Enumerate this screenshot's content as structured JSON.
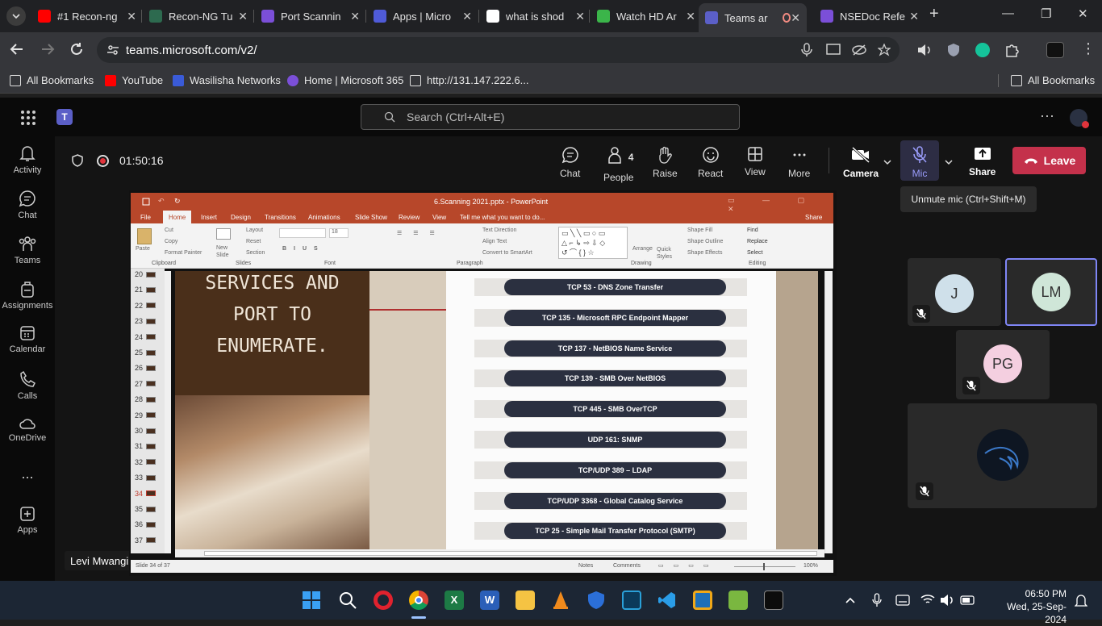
{
  "browser": {
    "tabs": [
      {
        "title": "#1 Recon-ng",
        "color": "#ff0000"
      },
      {
        "title": "Recon-NG Tu",
        "color": "#2d6a4f"
      },
      {
        "title": "Port Scannin",
        "color": "#7b4fd8"
      },
      {
        "title": "Apps | Micro",
        "color": "#4f5bd8"
      },
      {
        "title": "what is shod",
        "color": "#ffffff"
      },
      {
        "title": "Watch HD Ar",
        "color": "#3bb54a"
      },
      {
        "title": "Teams ar",
        "color": "#5b5fc7"
      },
      {
        "title": "NSEDoc Refe",
        "color": "#7b4fd8"
      }
    ],
    "url": "teams.microsoft.com/v2/",
    "bookmarks": [
      "All Bookmarks",
      "YouTube",
      "Wasilisha Networks",
      "Home | Microsoft 365",
      "http://131.147.222.6..."
    ],
    "bookmarks_right": "All Bookmarks"
  },
  "teams": {
    "search_placeholder": "Search (Ctrl+Alt+E)",
    "rail": [
      "Activity",
      "Chat",
      "Teams",
      "Assignments",
      "Calendar",
      "Calls",
      "OneDrive",
      "...",
      "Apps"
    ],
    "timer": "01:50:16",
    "controls": {
      "chat": "Chat",
      "people": "People",
      "people_count": "4",
      "raise": "Raise",
      "react": "React",
      "view": "View",
      "more": "More",
      "camera": "Camera",
      "mic": "Mic",
      "share": "Share",
      "leave": "Leave"
    },
    "tooltip": "Unmute mic (Ctrl+Shift+M)",
    "presenter": "Levi Mwangi",
    "participants": [
      {
        "initials": "J",
        "color": "#cfe0ea"
      },
      {
        "initials": "LM",
        "color": "#cfe6d8"
      },
      {
        "initials": "PG",
        "color": "#f4cfe0"
      }
    ]
  },
  "ppt": {
    "title": "6.Scanning 2021.pptx - PowerPoint",
    "tabs": [
      "File",
      "Home",
      "Insert",
      "Design",
      "Transitions",
      "Animations",
      "Slide Show",
      "Review",
      "View",
      "Tell me what you want to do...",
      "Share"
    ],
    "ribbon_groups": [
      "Clipboard",
      "Slides",
      "Font",
      "Paragraph",
      "Drawing",
      "Editing"
    ],
    "ribbon_items": {
      "paste": "Paste",
      "cut": "Cut",
      "copy": "Copy",
      "format_painter": "Format Painter",
      "new_slide": "New Slide",
      "layout": "Layout",
      "reset": "Reset",
      "section": "Section",
      "text_direction": "Text Direction",
      "align_text": "Align Text",
      "convert": "Convert to SmartArt",
      "arrange": "Arrange",
      "quick_styles": "Quick Styles",
      "shape_fill": "Shape Fill",
      "shape_outline": "Shape Outline",
      "shape_effects": "Shape Effects",
      "find": "Find",
      "replace": "Replace",
      "select": "Select",
      "font_size": "18"
    },
    "slide_numbers": [
      "20",
      "21",
      "22",
      "23",
      "24",
      "25",
      "26",
      "27",
      "28",
      "29",
      "30",
      "31",
      "32",
      "33",
      "34",
      "35",
      "36",
      "37"
    ],
    "current_slide": "34",
    "slide_heading": [
      "SERVICES AND",
      "PORT TO",
      "ENUMERATE."
    ],
    "ports": [
      "TCP 53 - DNS Zone Transfer",
      "TCP 135 - Microsoft RPC Endpoint Mapper",
      "TCP 137 - NetBIOS Name Service",
      "TCP 139 - SMB Over NetBIOS",
      "TCP 445 - SMB OverTCP",
      "UDP 161: SNMP",
      "TCP/UDP 389 – LDAP",
      "TCP/UDP 3368 - Global Catalog Service",
      "TCP 25 - Simple Mail Transfer Protocol (SMTP)"
    ],
    "status_left": "Slide 34 of 37",
    "status_notes": "Notes",
    "status_comments": "Comments",
    "zoom": "100%"
  },
  "taskbar": {
    "time": "06:50 PM",
    "date": "Wed, 25-Sep-2024"
  }
}
